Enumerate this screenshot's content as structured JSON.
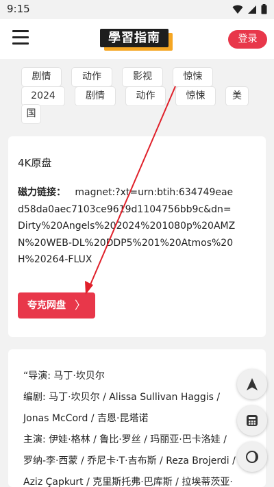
{
  "status_bar": {
    "time": "9:15"
  },
  "header": {
    "logo_text": "學習指南",
    "login_label": "登录"
  },
  "tags": [
    "剧情",
    "动作",
    "影视",
    "惊悚",
    "2024",
    "剧情",
    "动作",
    "惊悚",
    "美",
    "国"
  ],
  "resource": {
    "title": "4K原盘",
    "magnet_label": "磁力链接：",
    "magnet_value": "magnet:?xt=urn:btih:634749eaed58da0aec7103ce9619d1104756bb9c&dn=Dirty%20Angels%202024%201080p%20AMZN%20WEB-DL%20DDP5%201%20Atmos%20H%20264-FLUX",
    "button_label": "夸克网盘"
  },
  "credits": {
    "lines": [
      "“导演: 马丁·坎贝尔",
      "编剧: 马丁·坎贝尔 / Alissa Sullivan Haggis /",
      "Jonas McCord / 吉恩·昆塔诺",
      "主演: 伊娃·格林 / 鲁比·罗丝 / 玛丽亚·巴卡洛娃 /",
      "罗纳-李·西蒙 / 乔尼卡·T·吉布斯 / Reza Brojerdi /",
      "Aziz Çapkurt / 克里斯托弗·巴库斯 / 拉埃蒂茨亚·"
    ]
  },
  "fabs": {
    "icons": [
      "navigation-icon",
      "calculator-icon",
      "night-mode-icon"
    ]
  },
  "colors": {
    "accent": "#e8374a",
    "logo_accent": "#f5a623",
    "annotation_arrow": "#e0202a"
  }
}
